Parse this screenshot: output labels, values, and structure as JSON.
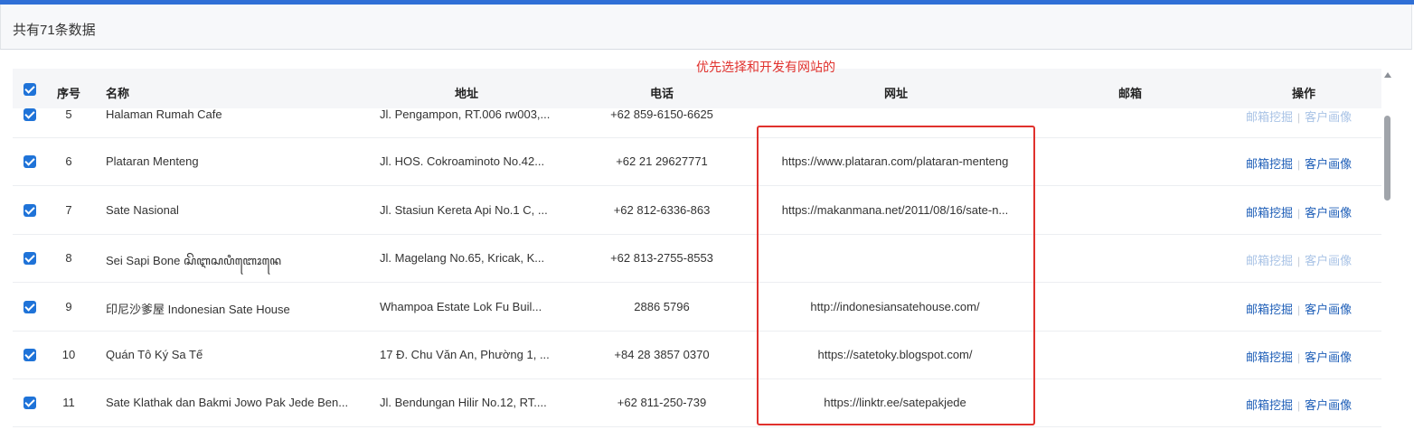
{
  "summary": {
    "text": "共有71条数据"
  },
  "annotation": {
    "text": "优先选择和开发有网站的"
  },
  "columns": {
    "seq": "序号",
    "name": "名称",
    "address": "地址",
    "phone": "电话",
    "website": "网址",
    "email": "邮箱",
    "actions": "操作"
  },
  "actions": {
    "email_mining": "邮箱挖掘",
    "customer_profile": "客户画像"
  },
  "rows": [
    {
      "seq": "5",
      "name": "Halaman Rumah Cafe",
      "address": "Jl. Pengampon, RT.006 rw003,...",
      "phone": "+62 859-6150-6625",
      "website": "",
      "email": "",
      "actions_enabled": false
    },
    {
      "seq": "6",
      "name": "Plataran Menteng",
      "address": "Jl. HOS. Cokroaminoto No.42...",
      "phone": "+62 21 29627771",
      "website": "https://www.plataran.com/plataran-menteng",
      "email": "",
      "actions_enabled": true
    },
    {
      "seq": "7",
      "name": "Sate Nasional",
      "address": "Jl. Stasiun Kereta Api No.1 C, ...",
      "phone": "+62 812-6336-863",
      "website": "https://makanmana.net/2011/08/16/sate-n...",
      "email": "",
      "actions_enabled": true
    },
    {
      "seq": "8",
      "name": "Sei Sapi Bone ꦱꦼꦆꦱꦥꦶꦧꦺꦴꦤꦺ",
      "address": "Jl. Magelang No.65, Kricak, K...",
      "phone": "+62 813-2755-8553",
      "website": "",
      "email": "",
      "actions_enabled": false
    },
    {
      "seq": "9",
      "name": "印尼沙爹屋 Indonesian Sate House",
      "address": "Whampoa Estate Lok Fu Buil...",
      "phone": "2886 5796",
      "website": "http://indonesiansatehouse.com/",
      "email": "",
      "actions_enabled": true
    },
    {
      "seq": "10",
      "name": "Quán Tô Ký Sa Tế",
      "address": "17 Đ. Chu Văn An, Phường 1, ...",
      "phone": "+84 28 3857 0370",
      "website": "https://satetoky.blogspot.com/",
      "email": "",
      "actions_enabled": true
    },
    {
      "seq": "11",
      "name": "Sate Klathak dan Bakmi Jowo Pak Jede Ben...",
      "address": "Jl. Bendungan Hilir No.12, RT....",
      "phone": "+62 811-250-739",
      "website": "https://linktr.ee/satepakjede",
      "email": "",
      "actions_enabled": true
    }
  ],
  "colors": {
    "accent": "#1f73d8",
    "link": "#1f5fb8",
    "annotation": "#e0312d"
  }
}
